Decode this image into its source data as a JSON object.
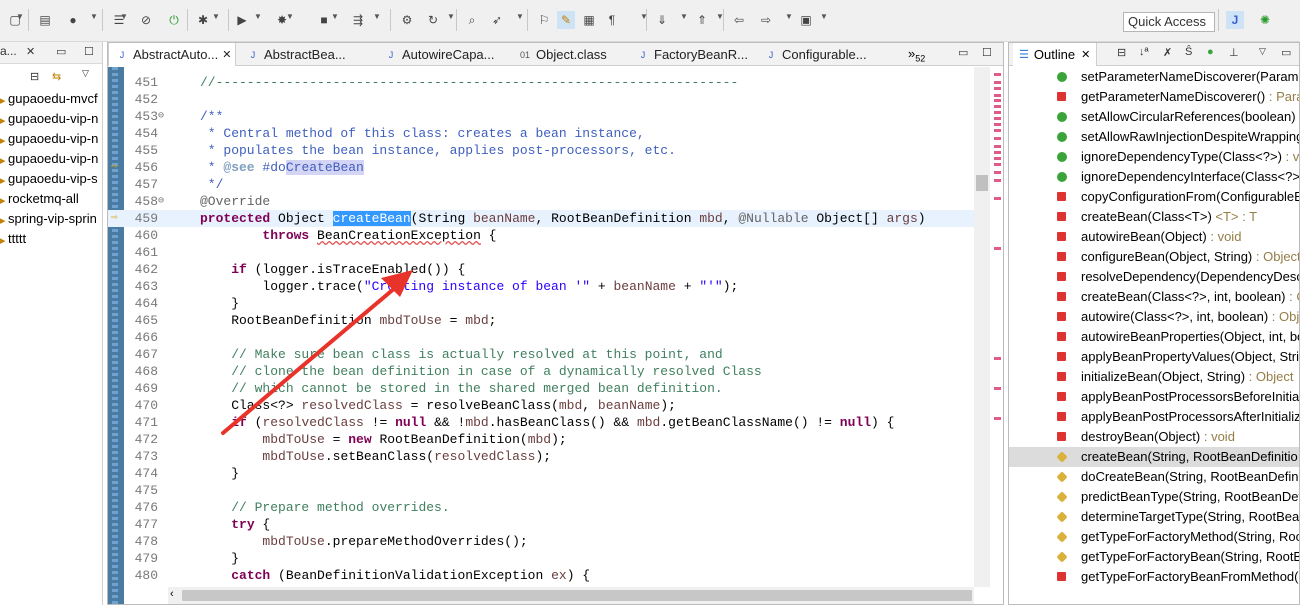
{
  "toolbar": {
    "quick_access": "Quick Access",
    "icons": [
      "new-icon",
      "save-icon",
      "profile-icon",
      "console-icon",
      "breakpoint-skip-icon",
      "run-icon",
      "debug-icon",
      "run-play-icon",
      "coverage-icon",
      "stop-icon",
      "external-tools-icon",
      "new-class-icon",
      "refresh-icon",
      "open-type-icon",
      "search-icon",
      "toggle-mark-icon",
      "highlight-icon",
      "block-select-icon",
      "whitespace-icon",
      "next-annotation-icon",
      "prev-annotation-icon",
      "back-icon",
      "forward-icon",
      "perspective-icon",
      "java-perspective-icon",
      "debug-perspective-icon"
    ]
  },
  "left_panel": {
    "tab_label": "a...",
    "projects": [
      "gupaoedu-mvcf",
      "gupaoedu-vip-n",
      "gupaoedu-vip-n",
      "gupaoedu-vip-n",
      "gupaoedu-vip-s",
      "rocketmq-all",
      "spring-vip-sprin",
      "ttttt"
    ]
  },
  "editor": {
    "tabs": [
      {
        "label": "AbstractAuto...",
        "active": true
      },
      {
        "label": "AbstractBea...",
        "active": false
      },
      {
        "label": "AutowireCapa...",
        "active": false
      },
      {
        "label": "Object.class",
        "active": false
      },
      {
        "label": "FactoryBeanR...",
        "active": false
      },
      {
        "label": "Configurable...",
        "active": false
      }
    ],
    "overflow": "»",
    "overflow_count": "52",
    "lines": [
      {
        "n": "451",
        "html": "<span class=\"c\">//-------------------------------------------------------------------</span>"
      },
      {
        "n": "452",
        "html": ""
      },
      {
        "n": "453",
        "html": "<span class=\"jd\">/**</span>"
      },
      {
        "n": "454",
        "html": "<span class=\"jd\"> * Central method of this class: creates a bean instance,</span>"
      },
      {
        "n": "455",
        "html": "<span class=\"jd\"> * populates the bean instance, applies post-processors, etc.</span>"
      },
      {
        "n": "456",
        "html": "<span class=\"jd\"> * <span style=\"color:#7f9fbf;font-weight:bold\">@see</span> #do<span class=\"occ\">CreateBean</span></span>"
      },
      {
        "n": "457",
        "html": "<span class=\"jd\"> */</span>"
      },
      {
        "n": "458",
        "html": "<span class=\"a\">@Override</span>"
      },
      {
        "n": "459",
        "html": "<span class=\"k\">protected</span> Object <span class=\"sel\">createBean</span>(String <span class=\"v\">beanName</span>, RootBeanDefinition <span class=\"v\">mbd</span>, <span class=\"a\">@Nullable</span> Object[] <span class=\"v\">args</span>)"
      },
      {
        "n": "460",
        "html": "        <span class=\"k\">throws</span> <span class=\"err\">BeanCreationException</span> {"
      },
      {
        "n": "461",
        "html": ""
      },
      {
        "n": "462",
        "html": "    <span class=\"k\">if</span> (logger.isTraceEnabled()) {"
      },
      {
        "n": "463",
        "html": "        logger.trace(<span class=\"s\">\"Creating instance of bean '\"</span> + <span class=\"v\">beanName</span> + <span class=\"s\">\"'\"</span>);"
      },
      {
        "n": "464",
        "html": "    }"
      },
      {
        "n": "465",
        "html": "    RootBeanDefinition <span class=\"v\">mbdToUse</span> = <span class=\"v\">mbd</span>;"
      },
      {
        "n": "466",
        "html": ""
      },
      {
        "n": "467",
        "html": "    <span class=\"c\">// Make sure bean class is actually resolved at this point, and</span>"
      },
      {
        "n": "468",
        "html": "    <span class=\"c\">// clone the bean definition in case of a dynamically resolved Class</span>"
      },
      {
        "n": "469",
        "html": "    <span class=\"c\">// which cannot be stored in the shared merged bean definition.</span>"
      },
      {
        "n": "470",
        "html": "    Class&lt;?&gt; <span class=\"v\">resolvedClass</span> = resolveBeanClass(<span class=\"v\">mbd</span>, <span class=\"v\">beanName</span>);"
      },
      {
        "n": "471",
        "html": "    <span class=\"k\">if</span> (<span class=\"v\">resolvedClass</span> != <span class=\"k\">null</span> &amp;&amp; !<span class=\"v\">mbd</span>.hasBeanClass() &amp;&amp; <span class=\"v\">mbd</span>.getBeanClassName() != <span class=\"k\">null</span>) {"
      },
      {
        "n": "472",
        "html": "        <span class=\"v\">mbdToUse</span> = <span class=\"k\">new</span> RootBeanDefinition(<span class=\"v\">mbd</span>);"
      },
      {
        "n": "473",
        "html": "        <span class=\"v\">mbdToUse</span>.setBeanClass(<span class=\"v\">resolvedClass</span>);"
      },
      {
        "n": "474",
        "html": "    }"
      },
      {
        "n": "475",
        "html": ""
      },
      {
        "n": "476",
        "html": "    <span class=\"c\">// Prepare method overrides.</span>"
      },
      {
        "n": "477",
        "html": "    <span class=\"k\">try</span> {"
      },
      {
        "n": "478",
        "html": "        <span class=\"v\">mbdToUse</span>.prepareMethodOverrides();"
      },
      {
        "n": "479",
        "html": "    }"
      },
      {
        "n": "480",
        "html": "    <span class=\"k\">catch</span> (BeanDefinitionValidationException <span class=\"v\">ex</span>) {"
      }
    ]
  },
  "outline": {
    "title": "Outline",
    "items": [
      {
        "name": "setParameterNameDiscoverer(Parame",
        "type": "",
        "vis": "pub"
      },
      {
        "name": "getParameterNameDiscoverer()",
        "type": " : Para",
        "vis": "priv"
      },
      {
        "name": "setAllowCircularReferences(boolean)",
        "type": " :",
        "vis": "pub"
      },
      {
        "name": "setAllowRawInjectionDespiteWrapping",
        "type": "",
        "vis": "pub"
      },
      {
        "name": "ignoreDependencyType(Class<?>)",
        "type": " : vo",
        "vis": "pub"
      },
      {
        "name": "ignoreDependencyInterface(Class<?>",
        "type": "",
        "vis": "pub"
      },
      {
        "name": "copyConfigurationFrom(ConfigurableB",
        "type": "",
        "vis": "priv"
      },
      {
        "name": "createBean(Class<T>)",
        "type": " <T> : T",
        "vis": "priv"
      },
      {
        "name": "autowireBean(Object)",
        "type": " : void",
        "vis": "priv"
      },
      {
        "name": "configureBean(Object, String)",
        "type": " : Object",
        "vis": "priv"
      },
      {
        "name": "resolveDependency(DependencyDesc",
        "type": "",
        "vis": "priv"
      },
      {
        "name": "createBean(Class<?>, int, boolean)",
        "type": " : C",
        "vis": "priv"
      },
      {
        "name": "autowire(Class<?>, int, boolean)",
        "type": " : Obj",
        "vis": "priv"
      },
      {
        "name": "autowireBeanProperties(Object, int, bo",
        "type": "",
        "vis": "priv"
      },
      {
        "name": "applyBeanPropertyValues(Object, Strin",
        "type": "",
        "vis": "priv"
      },
      {
        "name": "initializeBean(Object, String)",
        "type": " : Object",
        "vis": "priv"
      },
      {
        "name": "applyBeanPostProcessorsBeforeInitial",
        "type": "",
        "vis": "priv"
      },
      {
        "name": "applyBeanPostProcessorsAfterInitializ",
        "type": "",
        "vis": "priv"
      },
      {
        "name": "destroyBean(Object)",
        "type": " : void",
        "vis": "priv"
      },
      {
        "name": "createBean(String, RootBeanDefinitio",
        "type": "",
        "vis": "prot"
      },
      {
        "name": "doCreateBean(String, RootBeanDefini",
        "type": "",
        "vis": "prot"
      },
      {
        "name": "predictBeanType(String, RootBeanDef",
        "type": "",
        "vis": "prot"
      },
      {
        "name": "determineTargetType(String, RootBea",
        "type": "",
        "vis": "prot"
      },
      {
        "name": "getTypeForFactoryMethod(String, Roo",
        "type": "",
        "vis": "prot"
      },
      {
        "name": "getTypeForFactoryBean(String, RootB",
        "type": "",
        "vis": "prot"
      },
      {
        "name": "getTypeForFactoryBeanFromMethod(",
        "type": "",
        "vis": "priv"
      }
    ]
  },
  "colors": {
    "keyword": "#7f0055",
    "comment": "#3f7f5f",
    "javadoc": "#3f5fbf",
    "string": "#2a00ff",
    "selection": "#3399ff",
    "annotation_arrow": "#e8332a"
  }
}
